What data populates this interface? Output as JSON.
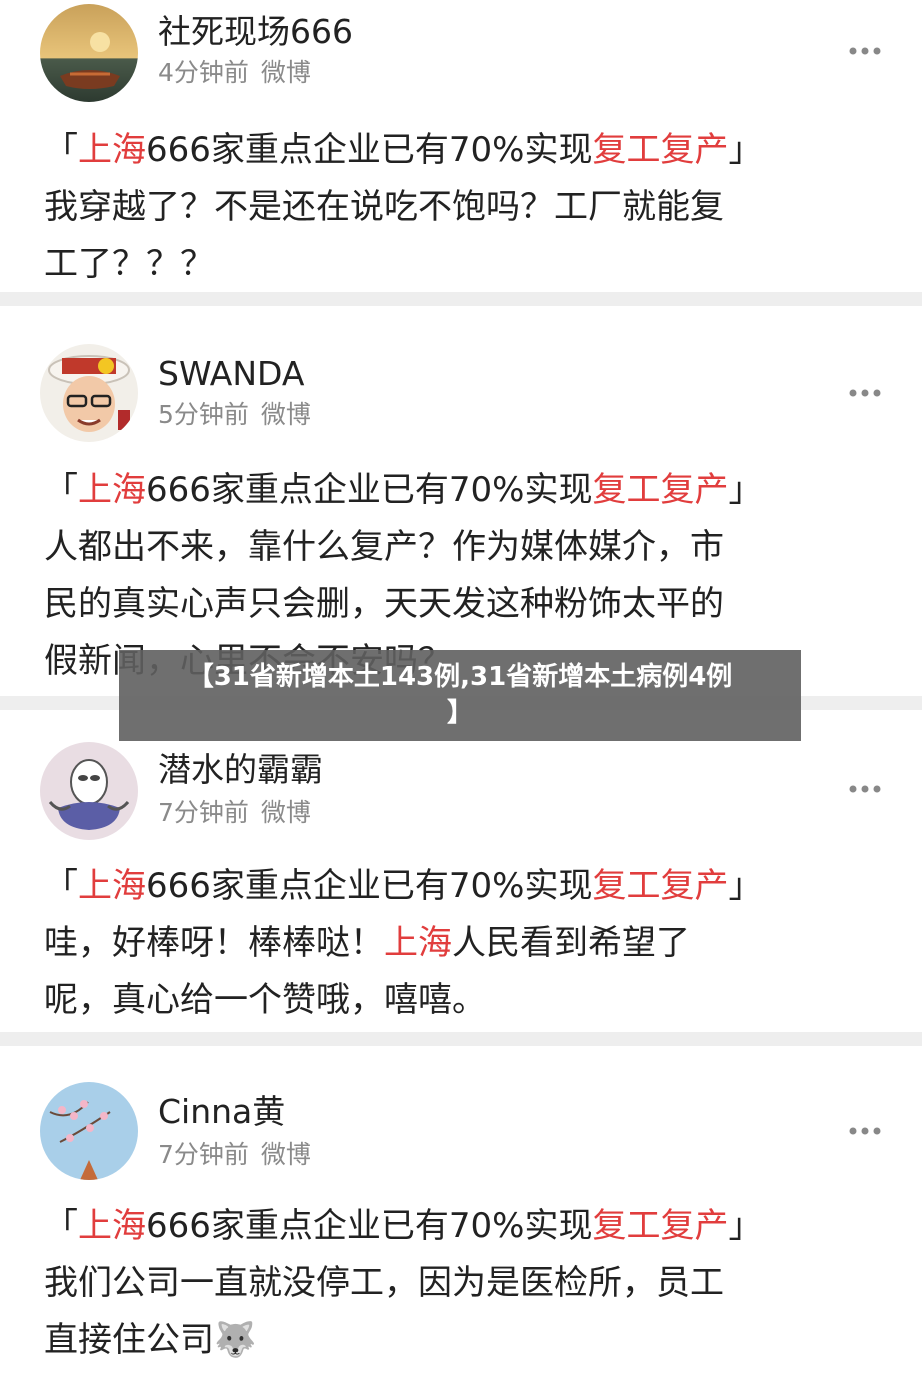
{
  "posts": [
    {
      "username": "社死现场666",
      "time": "4分钟前",
      "source": "微博",
      "body_lines": [
        [
          "「",
          "上海",
          "666家重点企业已有70%实现",
          "复工复产",
          "」"
        ],
        [
          "我穿越了？不是还在说吃不饱吗？工厂就能复"
        ],
        [
          "工了？？？"
        ]
      ]
    },
    {
      "username": "SWANDA",
      "time": "5分钟前",
      "source": "微博",
      "body_lines": [
        [
          "「",
          "上海",
          "666家重点企业已有70%实现",
          "复工复产",
          "」"
        ],
        [
          "人都出不来，靠什么复产？作为媒体媒介，市"
        ],
        [
          "民的真实心声只会删，天天发这种粉饰太平的"
        ],
        [
          "假新闻，心里不会不安吗？"
        ]
      ]
    },
    {
      "username": "潜水的霸霸",
      "time": "7分钟前",
      "source": "微博",
      "body_lines": [
        [
          "「",
          "上海",
          "666家重点企业已有70%实现",
          "复工复产",
          "」"
        ],
        [
          "哇，好棒呀！棒棒哒！",
          "上海",
          "人民看到希望了"
        ],
        [
          "呢，真心给一个赞哦，嘻嘻。"
        ]
      ]
    },
    {
      "username": "Cinna黄",
      "time": "7分钟前",
      "source": "微博",
      "body_lines": [
        [
          "「",
          "上海",
          "666家重点企业已有70%实现",
          "复工复产",
          "」"
        ],
        [
          "我们公司一直就没停工，因为是医检所，员工"
        ],
        [
          "直接住公司",
          "🐺"
        ]
      ]
    }
  ],
  "banner": {
    "line1": "【31省新增本土143例,31省新增本土病例4例",
    "line2": "】"
  },
  "icons": {
    "more": "more-dots-icon",
    "emoji": "wolf-emoji-icon"
  },
  "colors": {
    "highlight": "#e13d3d",
    "meta": "#8a8a8a",
    "divider": "#eeeeee"
  }
}
